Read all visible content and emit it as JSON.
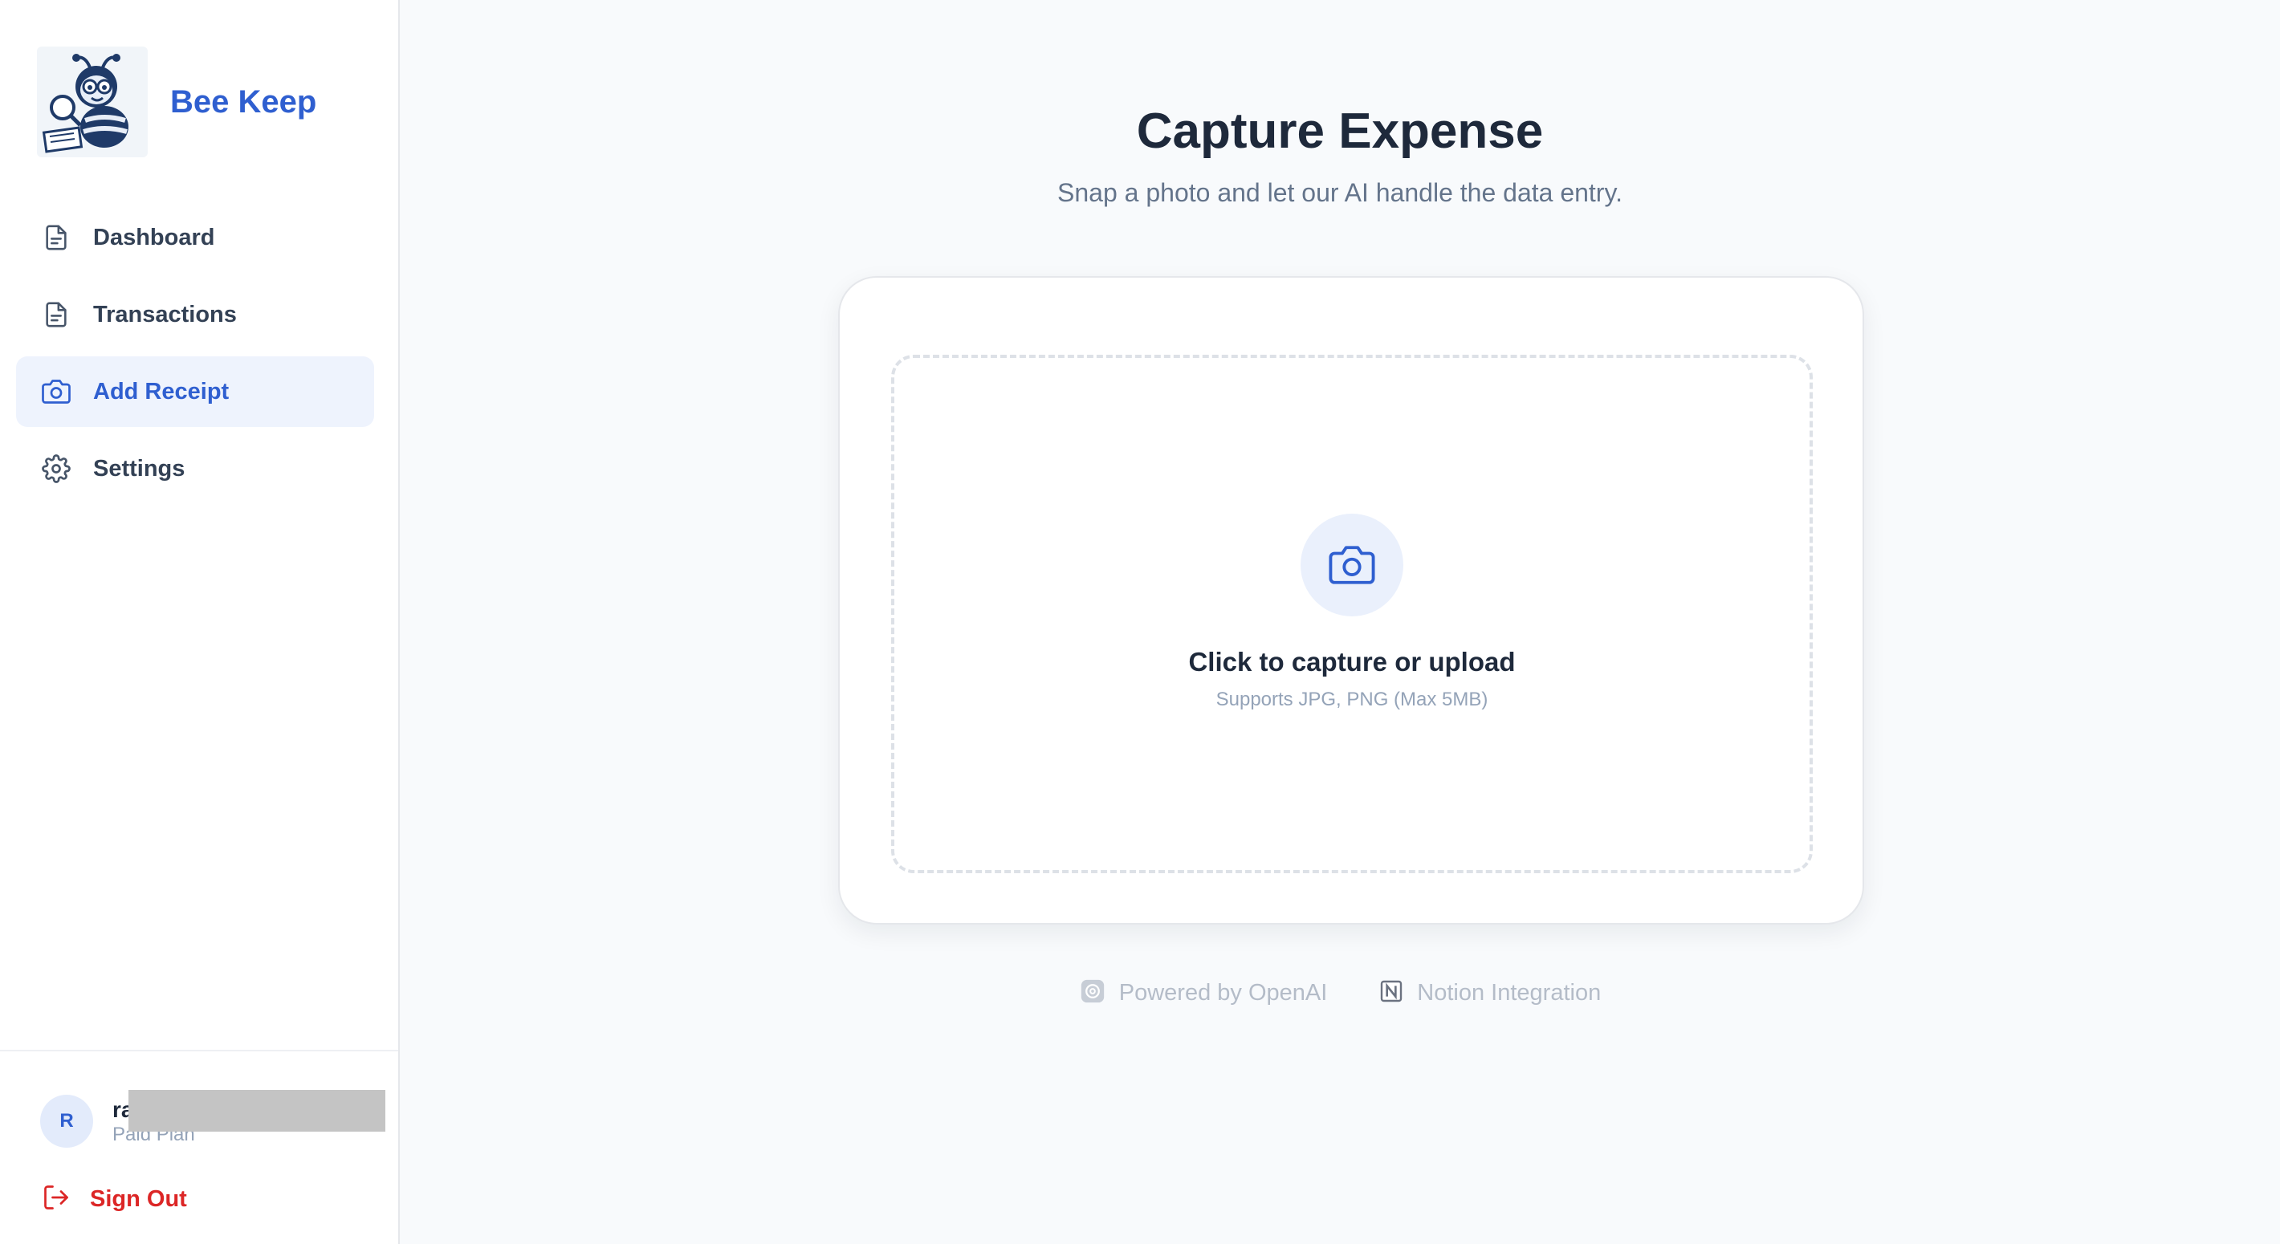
{
  "brand": {
    "name": "Bee Keep"
  },
  "nav": {
    "items": [
      {
        "label": "Dashboard",
        "icon": "document-icon",
        "active": false
      },
      {
        "label": "Transactions",
        "icon": "document-icon",
        "active": false
      },
      {
        "label": "Add Receipt",
        "icon": "camera-icon",
        "active": true
      },
      {
        "label": "Settings",
        "icon": "gear-icon",
        "active": false
      }
    ]
  },
  "user": {
    "initial": "R",
    "name": "ra",
    "plan": "Paid Plan"
  },
  "signout": {
    "label": "Sign Out"
  },
  "page": {
    "title": "Capture Expense",
    "subtitle": "Snap a photo and let our AI handle the data entry."
  },
  "upload": {
    "title": "Click to capture or upload",
    "hint": "Supports JPG, PNG (Max 5MB)"
  },
  "badges": [
    {
      "label": "Powered by OpenAI",
      "icon": "openai-icon"
    },
    {
      "label": "Notion Integration",
      "icon": "notion-icon"
    }
  ],
  "colors": {
    "accent": "#2f5fd0",
    "active_bg": "#eef3fd",
    "danger": "#dc2626",
    "background": "#f8fafc"
  }
}
